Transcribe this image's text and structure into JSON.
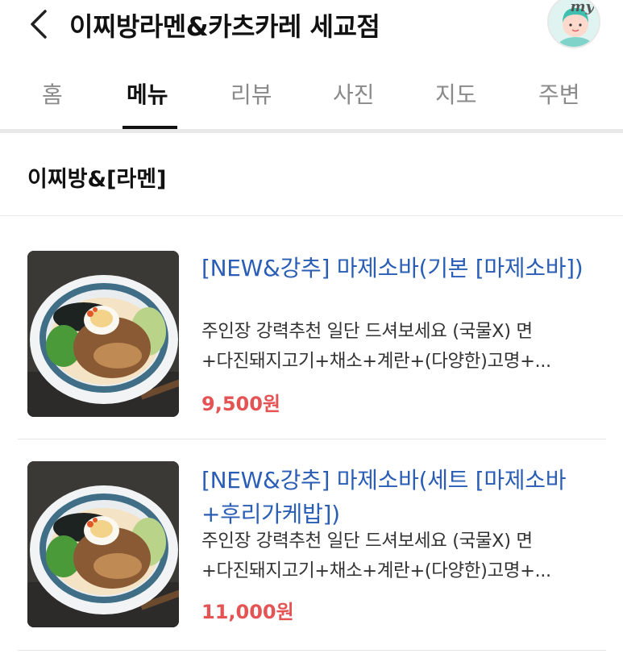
{
  "header": {
    "title": "이찌방라멘&카츠카레 세교점",
    "avatar_text": "my"
  },
  "tabs": [
    {
      "label": "홈"
    },
    {
      "label": "메뉴"
    },
    {
      "label": "리뷰"
    },
    {
      "label": "사진"
    },
    {
      "label": "지도"
    },
    {
      "label": "주변"
    }
  ],
  "active_tab": "메뉴",
  "section": {
    "title": "이찌방&[라멘]"
  },
  "menu_items": [
    {
      "name": "[NEW&강추] 마제소바(기본 [마제소바])",
      "desc_line1": "주인장 강력추천 일단 드셔보세요 (국물X) 면",
      "desc_line2": "+다진돼지고기+채소+계란+(다양한)고명+...",
      "price": "9,500원"
    },
    {
      "name": "[NEW&강추] 마제소바(세트 [마제소바+후리가케밥])",
      "desc_line1": "주인장 강력추천 일단 드셔보세요 (국물X) 면",
      "desc_line2": "+다진돼지고기+채소+계란+(다양한)고명+...",
      "price": "11,000원"
    }
  ],
  "colors": {
    "item_name": "#2a5db5",
    "price": "#e45454",
    "active_tab_underline": "#111111"
  }
}
